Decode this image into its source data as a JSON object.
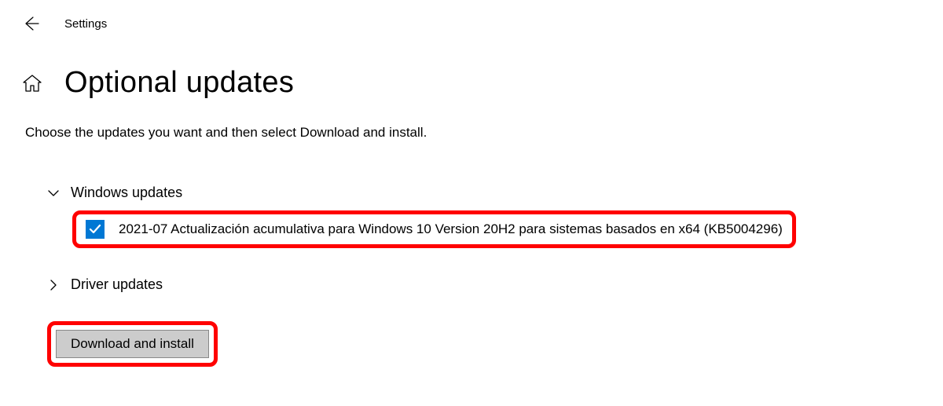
{
  "titlebar": {
    "title": "Settings"
  },
  "page": {
    "title": "Optional updates",
    "instruction": "Choose the updates you want and then select Download and install."
  },
  "sections": {
    "windows_updates": {
      "title": "Windows updates",
      "expanded": true,
      "items": [
        {
          "checked": true,
          "label": "2021-07 Actualización acumulativa para Windows 10 Version 20H2 para sistemas basados en x64 (KB5004296)"
        }
      ]
    },
    "driver_updates": {
      "title": "Driver updates",
      "expanded": false
    }
  },
  "actions": {
    "download_install": "Download and install"
  }
}
